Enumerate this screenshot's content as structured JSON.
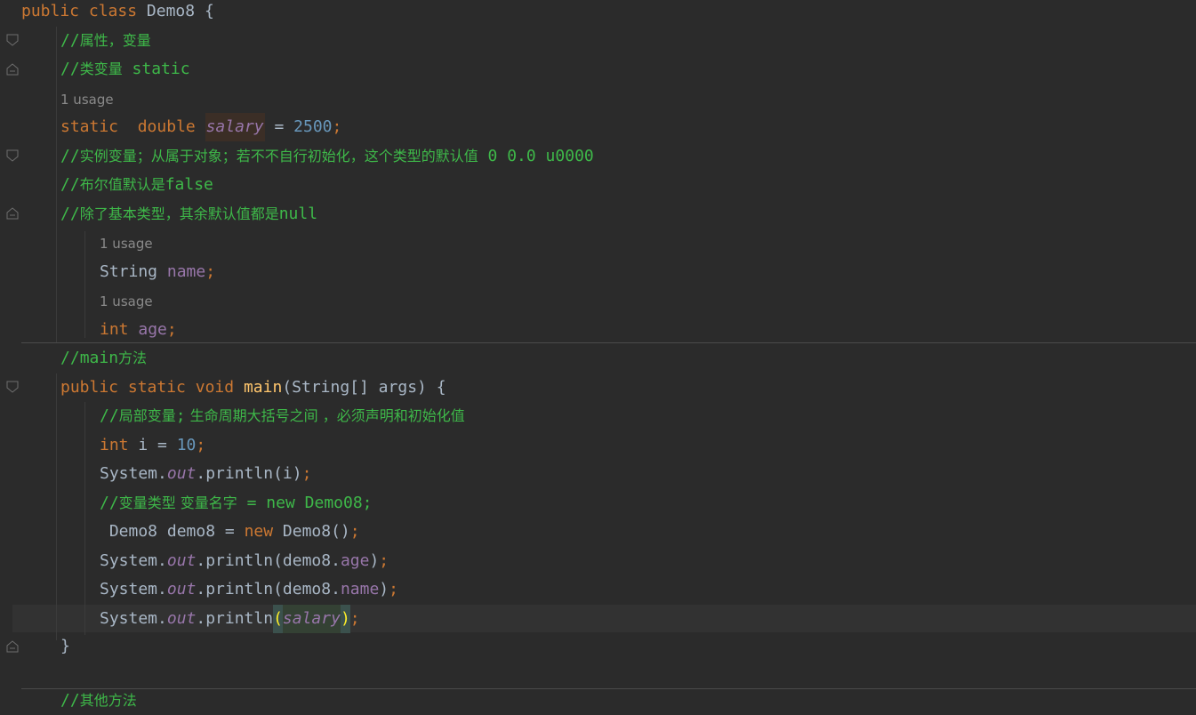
{
  "editor": {
    "usage_hint": "1 usage",
    "lines": {
      "l1": {
        "kw_public": "public",
        "kw_class": "class",
        "name": "Demo8",
        "brace": "{"
      },
      "l2": {
        "slashes": "//",
        "text": "属性，变量"
      },
      "l3": {
        "slashes": "//",
        "text": "类变量",
        "code": " static"
      },
      "l4": {
        "kw_static": "static",
        "kw_double": "double",
        "var": "salary",
        "eq": " = ",
        "num": "2500",
        "semi": ";"
      },
      "l5": {
        "slashes": "//",
        "text": "实例变量；从属于对象；若不不自行初始化，这个类型的默认值",
        "code": " 0 0.0 u0000"
      },
      "l6": {
        "slashes": "//",
        "text": "布尔值默认是",
        "code": "false"
      },
      "l7": {
        "slashes": "//",
        "text": "除了基本类型，其余默认值都是",
        "code": "null"
      },
      "l8": {
        "type": "String",
        "var": "name",
        "semi": ";"
      },
      "l9": {
        "kw_int": "int",
        "var": "age",
        "semi": ";"
      },
      "l10": {
        "slashes": "//",
        "code": "main",
        "text": "方法"
      },
      "l11": {
        "kw_public": "public",
        "kw_static": "static",
        "kw_void": "void",
        "fn": "main",
        "params": "(String[] args) {"
      },
      "l12": {
        "slashes": "//",
        "text": "局部变量",
        "code": ";",
        "text2": " 生命周期大括号之间 ，必须声明和初始化值"
      },
      "l13": {
        "kw_int": "int",
        "rest": " i = ",
        "num": "10",
        "semi": ";"
      },
      "l14": {
        "sys": "System.",
        "out": "out",
        "call": ".println(i)",
        "semi": ";"
      },
      "l15": {
        "slashes": "//",
        "text": "变量类型 变量名字",
        "code": " = new Demo08;"
      },
      "l16": {
        "pre": " Demo8 demo8 = ",
        "kw_new": "new",
        "post": " Demo8()",
        "semi": ";"
      },
      "l17": {
        "sys": "System.",
        "out": "out",
        "call": ".println(demo8.",
        "field": "age",
        "close": ")",
        "semi": ";"
      },
      "l18": {
        "sys": "System.",
        "out": "out",
        "call": ".println(demo8.",
        "field": "name",
        "close": ")",
        "semi": ";"
      },
      "l19": {
        "sys": "System.",
        "out": "out",
        "call": ".println",
        "open": "(",
        "var": "salary",
        "close": ")",
        "semi": ";"
      },
      "l20": {
        "brace": "}"
      },
      "l21": {
        "slashes": "//",
        "text": "其他方法"
      }
    },
    "colors": {
      "background": "#2b2b2b",
      "keyword": "#cc7832",
      "comment": "#3eb849",
      "field": "#9876aa",
      "number": "#6897bb",
      "method": "#ffc66d",
      "text": "#a9b7c6"
    }
  }
}
